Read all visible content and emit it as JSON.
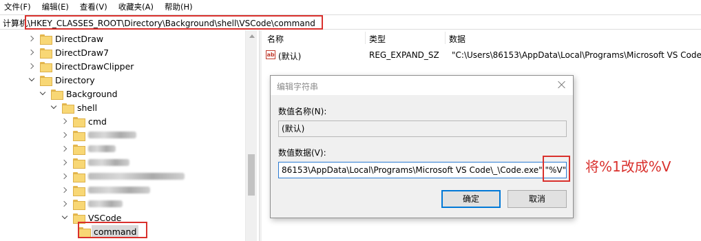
{
  "menubar": {
    "items": [
      "文件(F)",
      "编辑(E)",
      "查看(V)",
      "收藏夹(A)",
      "帮助(H)"
    ]
  },
  "address": {
    "path": "计算机\\HKEY_CLASSES_ROOT\\Directory\\Background\\shell\\VSCode\\command"
  },
  "tree": {
    "items": [
      {
        "label": "DirectDraw",
        "blurred": false
      },
      {
        "label": "DirectDraw7",
        "blurred": false
      },
      {
        "label": "DirectDrawClipper",
        "blurred": false
      },
      {
        "label": "Directory",
        "blurred": false
      },
      {
        "label": "Background",
        "blurred": false
      },
      {
        "label": "shell",
        "blurred": false
      },
      {
        "label": "cmd",
        "blurred": false
      },
      {
        "label": "",
        "blurred": true
      },
      {
        "label": "",
        "blurred": true
      },
      {
        "label": "",
        "blurred": true
      },
      {
        "label": "",
        "blurred": true
      },
      {
        "label": "",
        "blurred": true
      },
      {
        "label": "",
        "blurred": true
      },
      {
        "label": "VSCode",
        "blurred": false
      },
      {
        "label": "command",
        "blurred": false
      }
    ]
  },
  "list": {
    "headers": {
      "name": "名称",
      "type": "类型",
      "data": "数据"
    },
    "rows": [
      {
        "name": "(默认)",
        "type": "REG_EXPAND_SZ",
        "data": "\"C:\\Users\\86153\\AppData\\Local\\Programs\\Microsoft VS Code\\"
      }
    ]
  },
  "dialog": {
    "title": "编辑字符串",
    "name_label": "数值名称(N):",
    "name_value": "(默认)",
    "data_label": "数值数据(V):",
    "data_value": "86153\\AppData\\Local\\Programs\\Microsoft VS Code\\_\\Code.exe\" \"%V\"",
    "ok_label": "确定",
    "cancel_label": "取消"
  },
  "annotation": {
    "text": "将%1改成%V",
    "color": "#d9302c"
  }
}
